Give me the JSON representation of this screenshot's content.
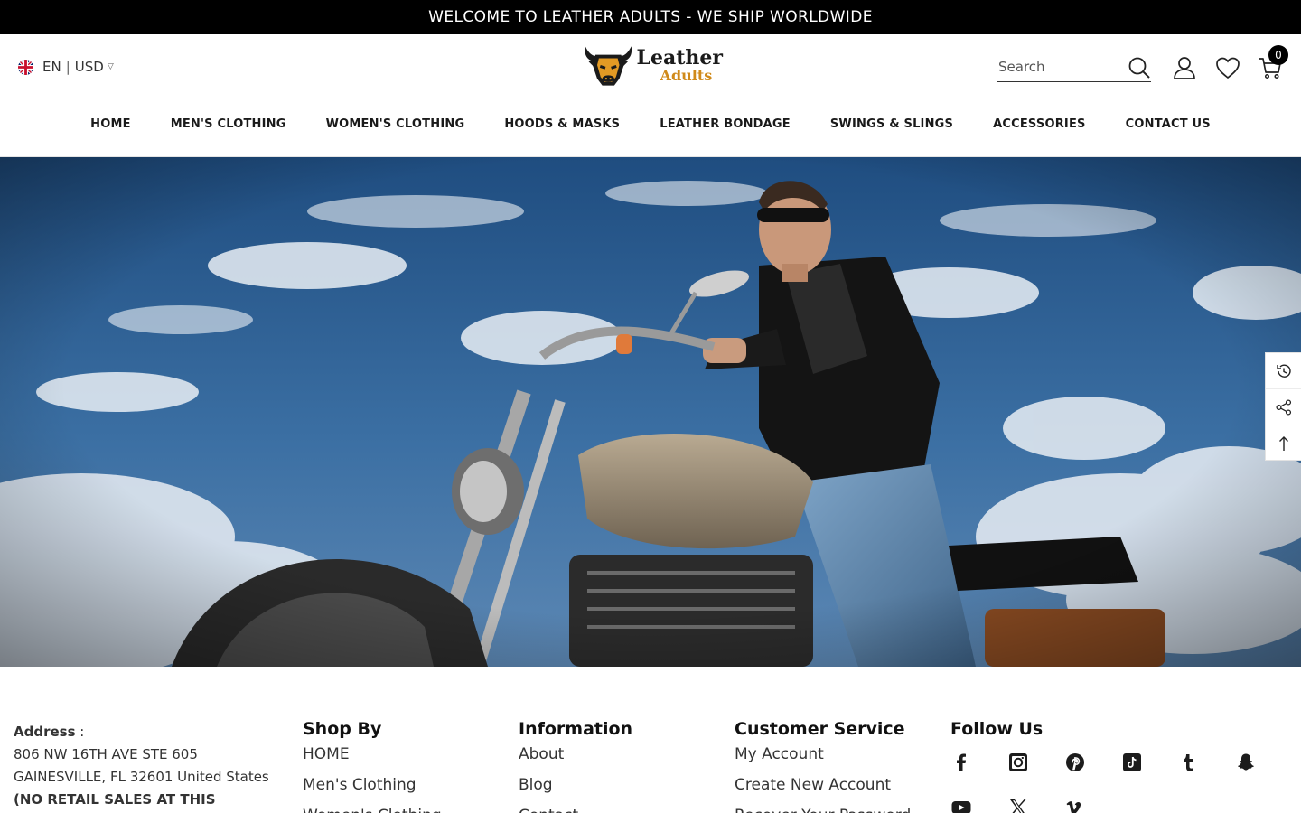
{
  "announcement": "WELCOME TO LEATHER ADULTS - WE SHIP WORLDWIDE",
  "locale": {
    "language": "EN",
    "separator": "|",
    "currency": "USD"
  },
  "logo": {
    "line1": "Leather",
    "line2": "Adults"
  },
  "search": {
    "placeholder": "Search"
  },
  "cart": {
    "count": "0"
  },
  "nav": [
    "HOME",
    "MEN'S CLOTHING",
    "WOMEN'S CLOTHING",
    "HOODS & MASKS",
    "LEATHER BONDAGE",
    "SWINGS & SLINGS",
    "ACCESSORIES",
    "CONTACT US"
  ],
  "footer": {
    "address": {
      "label": "Address",
      "colon": " :",
      "line1": "806 NW 16TH AVE STE 605",
      "line2": "GAINESVILLE, FL 32601 United States",
      "line3": "(NO RETAIL SALES AT THIS"
    },
    "shop_by": {
      "title": "Shop By",
      "links": [
        "HOME",
        "Men's Clothing",
        "Women's Clothing"
      ]
    },
    "information": {
      "title": "Information",
      "links": [
        "About",
        "Blog",
        "Contact"
      ]
    },
    "customer_service": {
      "title": "Customer Service",
      "links": [
        "My Account",
        "Create New Account",
        "Recover Your Password"
      ]
    },
    "follow_us": {
      "title": "Follow Us"
    }
  },
  "icons": {
    "social": [
      "facebook-icon",
      "instagram-icon",
      "pinterest-icon",
      "tiktok-icon",
      "tumblr-icon",
      "snapchat-icon",
      "youtube-icon",
      "x-icon",
      "vimeo-icon"
    ],
    "tools": [
      "recently-viewed-icon",
      "share-icon",
      "back-to-top-icon"
    ]
  },
  "colors": {
    "announcement_bg": "#000000",
    "logo_gold": "#d08a1a",
    "text": "#222222"
  }
}
